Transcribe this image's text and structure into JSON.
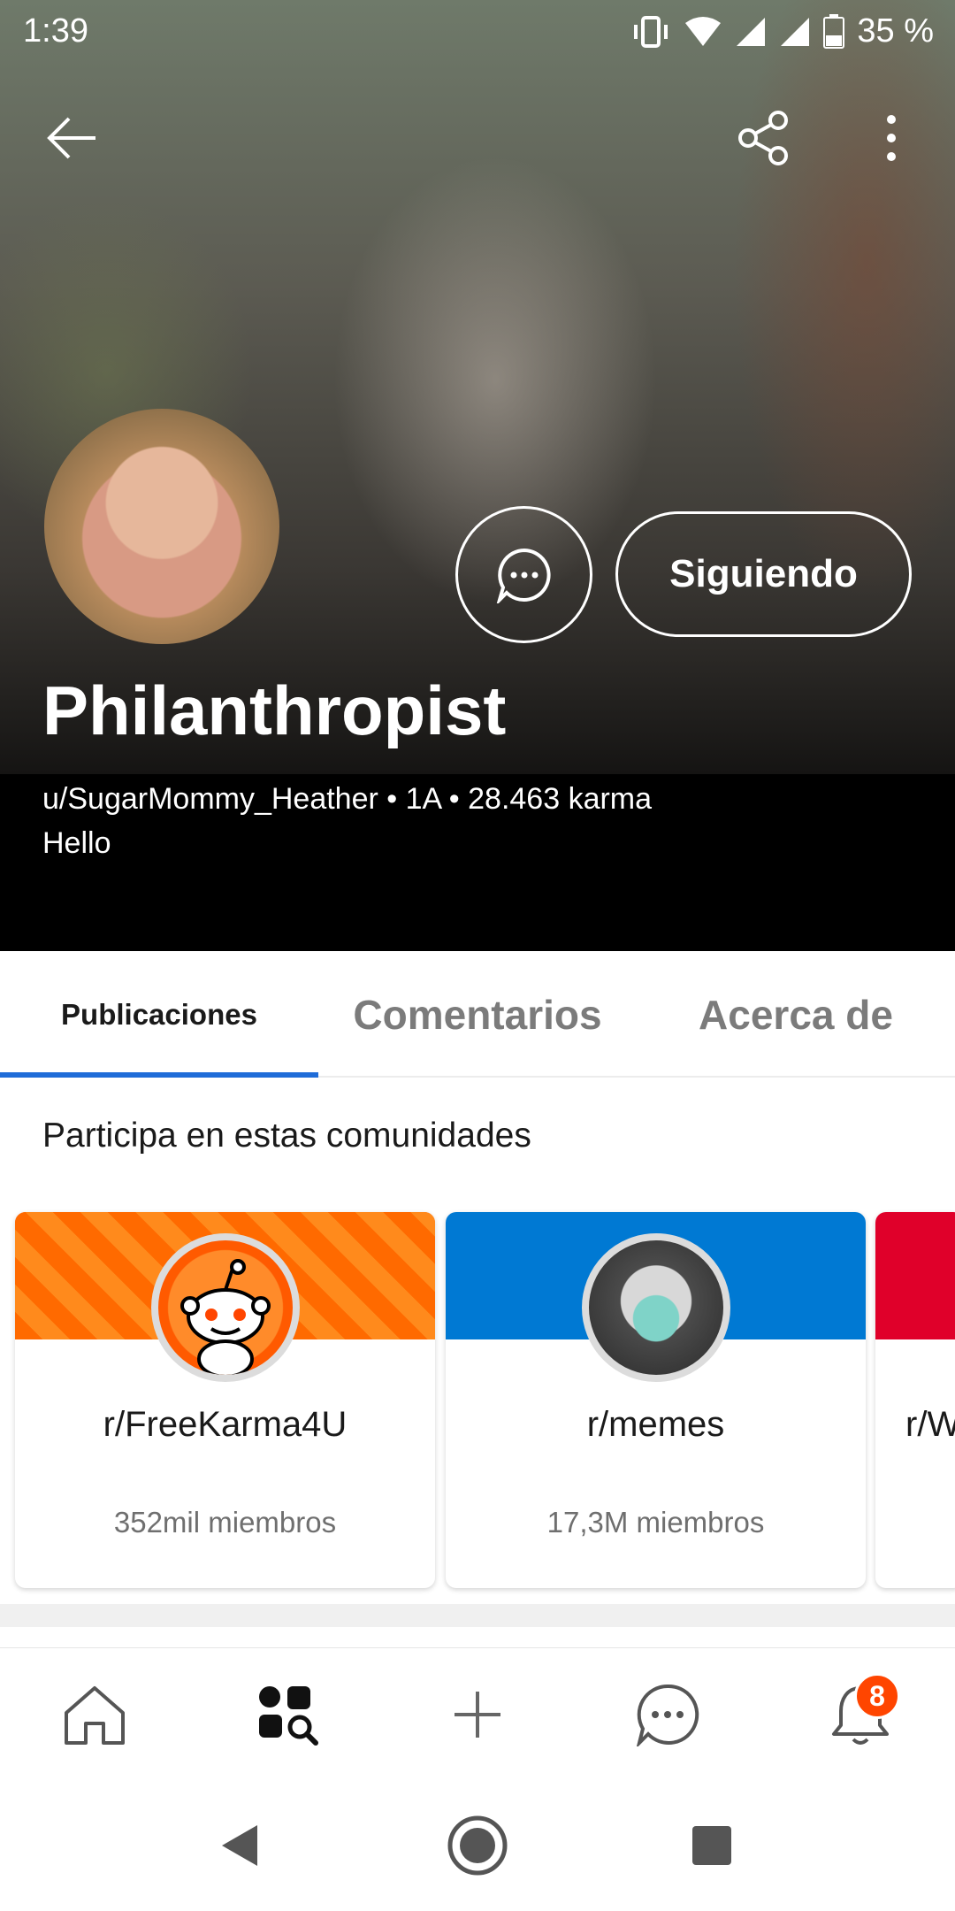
{
  "status_bar": {
    "time": "1:39",
    "battery": "35 %"
  },
  "profile": {
    "display_name": "Philanthropist",
    "meta": "u/SugarMommy_Heather • 1A • 28.463 karma",
    "bio": "Hello",
    "follow_label": "Siguiendo"
  },
  "tabs": [
    {
      "label": "Publicaciones",
      "active": true
    },
    {
      "label": "Comentarios",
      "active": false
    },
    {
      "label": "Acerca de",
      "active": false
    }
  ],
  "communities": {
    "title": "Participa en estas comunidades",
    "items": [
      {
        "prefix": "r/",
        "name": "FreeKarma4U",
        "members": "352mil miembros",
        "banner_color": "#ff5700"
      },
      {
        "prefix": "r/",
        "name": "memes",
        "members": "17,3M miembros",
        "banner_color": "#0079d3"
      },
      {
        "prefix": "r/",
        "name": "W",
        "members": "",
        "banner_color": "#e0002a"
      }
    ]
  },
  "bottom_nav": {
    "items": [
      "home-icon",
      "discover-icon",
      "create-icon",
      "chat-icon",
      "inbox-icon"
    ],
    "inbox_badge": "8"
  },
  "colors": {
    "accent": "#1f6cd8",
    "badge": "#ff4500"
  }
}
